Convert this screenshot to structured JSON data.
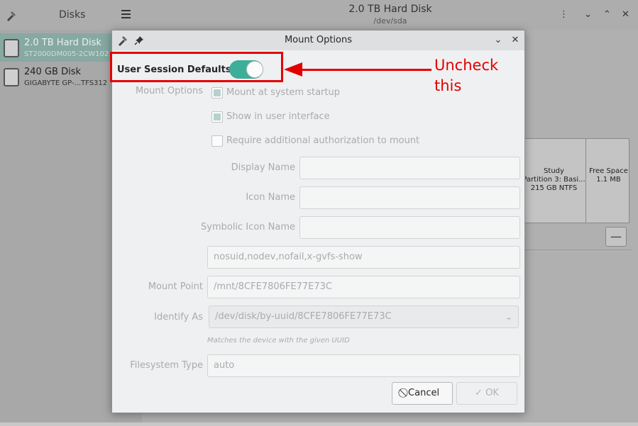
{
  "app": {
    "sidebar_title": "Disks",
    "window_title": "2.0 TB Hard Disk",
    "window_subtitle": "/dev/sda",
    "disks": [
      {
        "name": "2.0 TB Hard Disk",
        "model": "ST2000DM005-2CW102",
        "selected": true
      },
      {
        "name": "240 GB Disk",
        "model": "GIGABYTE GP-...TFS312",
        "selected": false
      }
    ],
    "partitions": [
      {
        "label": "Study",
        "detail1": "Partition 3: Basi...",
        "detail2": "215 GB NTFS"
      },
      {
        "label": "Free Space",
        "detail1": "1.1 MB",
        "detail2": ""
      }
    ],
    "minus_label": "—"
  },
  "dialog": {
    "title": "Mount Options",
    "user_session_defaults": {
      "label": "User Session Defaults",
      "enabled": true
    },
    "mount_options_label": "Mount Options",
    "checkboxes": [
      {
        "label": "Mount at system startup",
        "checked": true
      },
      {
        "label": "Show in user interface",
        "checked": true
      },
      {
        "label": "Require additional authorization to mount",
        "checked": false
      }
    ],
    "display_name": {
      "label": "Display Name",
      "value": ""
    },
    "icon_name": {
      "label": "Icon Name",
      "value": ""
    },
    "symbolic_icon_name": {
      "label": "Symbolic Icon Name",
      "value": ""
    },
    "options_value": "nosuid,nodev,nofail,x-gvfs-show",
    "mount_point": {
      "label": "Mount Point",
      "value": "/mnt/8CFE7806FE77E73C"
    },
    "identify_as": {
      "label": "Identify As",
      "value": "/dev/disk/by-uuid/8CFE7806FE77E73C",
      "hint": "Matches the device with the given UUID"
    },
    "filesystem_type": {
      "label": "Filesystem Type",
      "value": "auto"
    },
    "cancel_label": "Cancel",
    "ok_label": "OK"
  },
  "annotation": {
    "text": "Uncheck\nthis",
    "color": "#e30000"
  }
}
